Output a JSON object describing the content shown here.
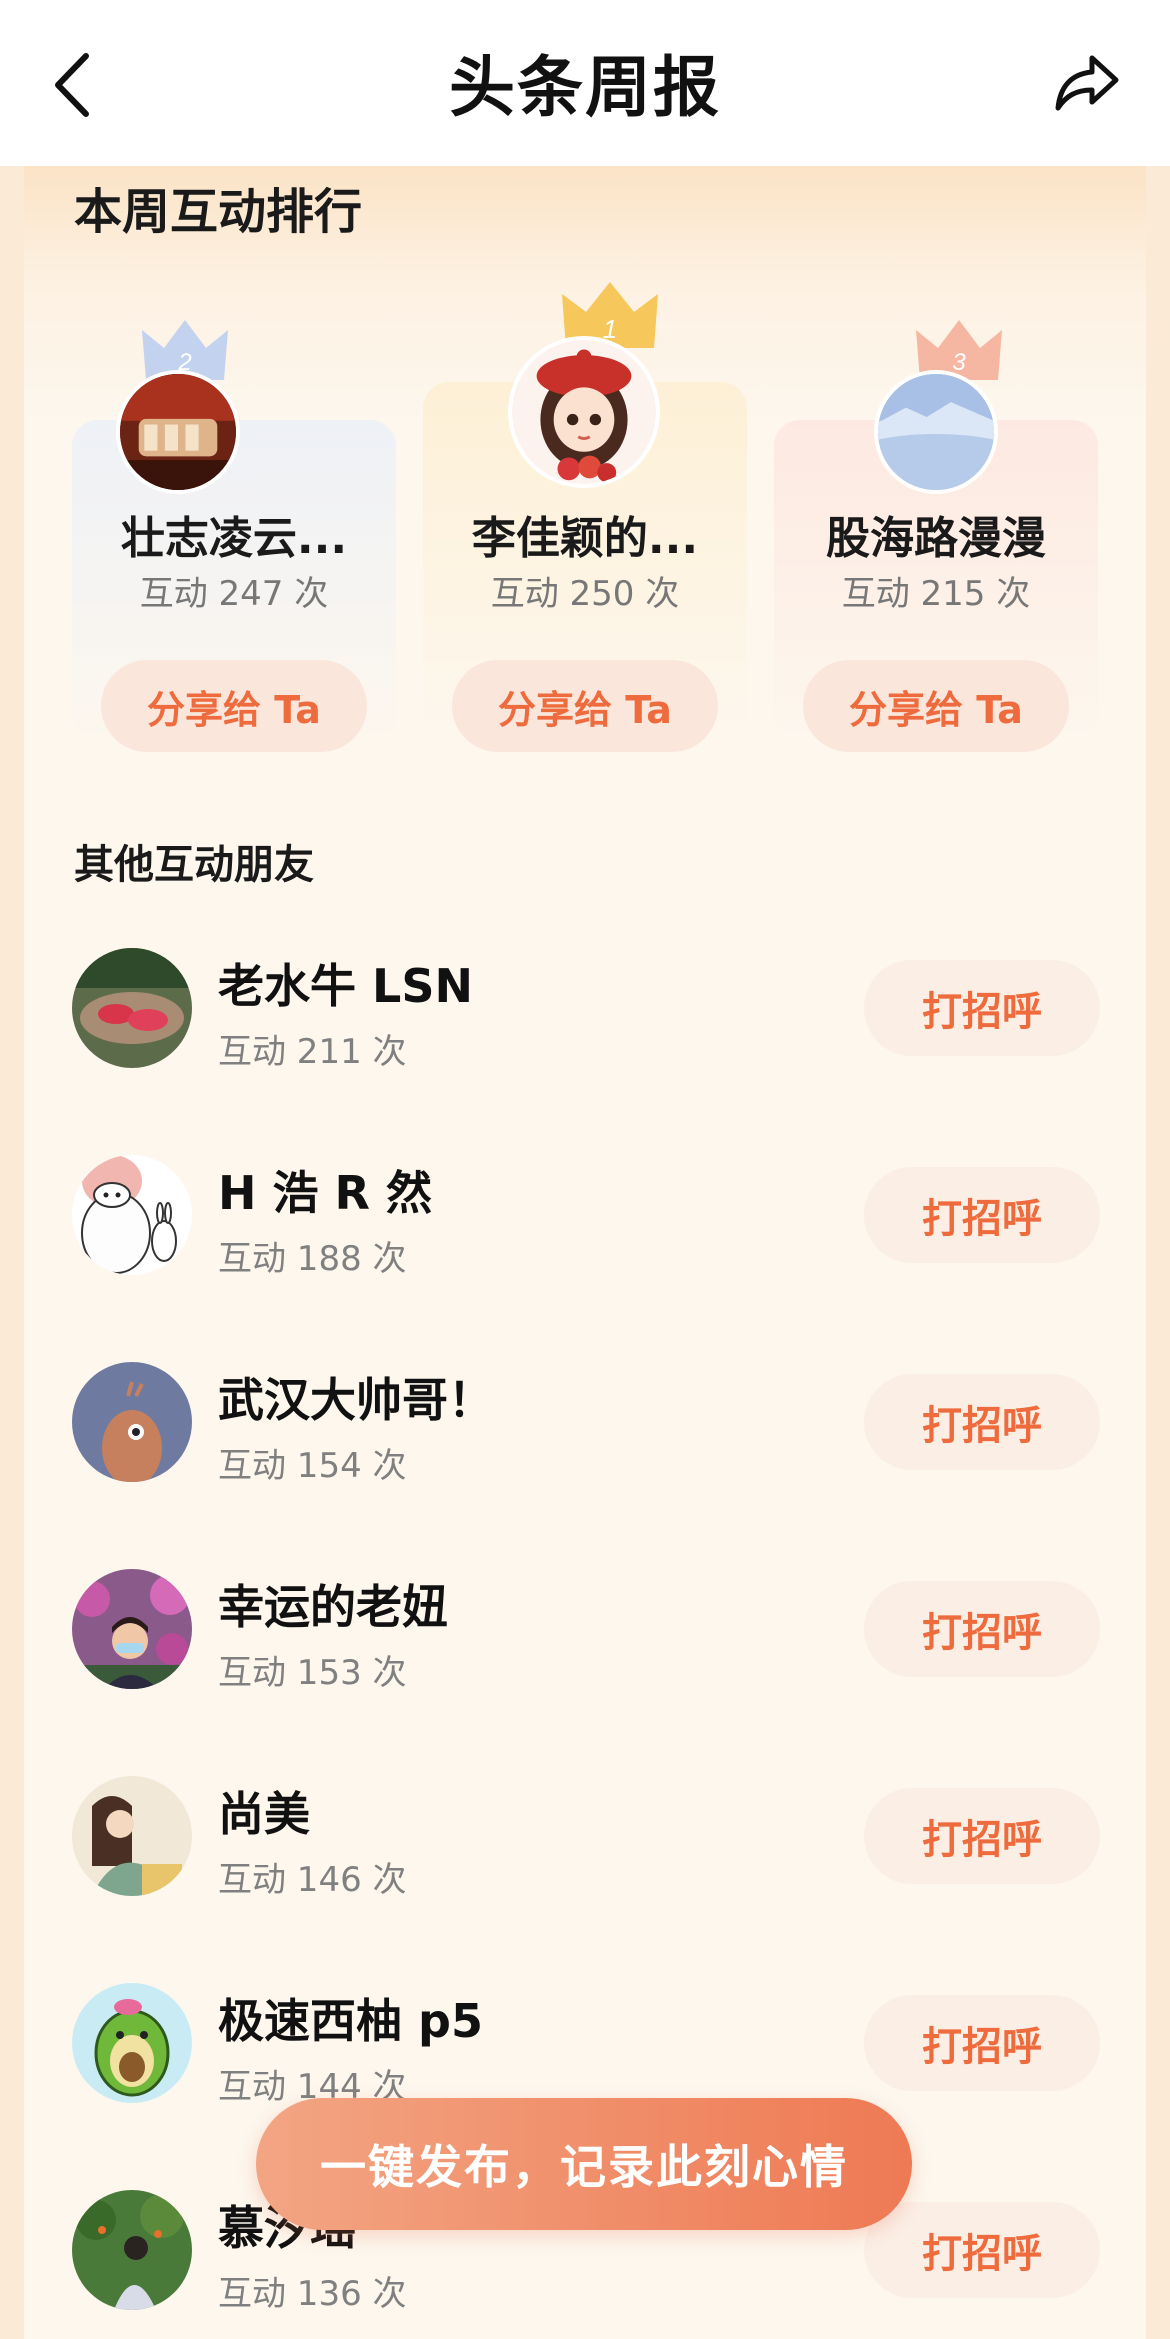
{
  "header": {
    "title": "头条周报",
    "back_icon": "chevron-left-icon",
    "share_icon": "share-arrow-icon"
  },
  "ranking": {
    "title": "本周互动排行",
    "podium": [
      {
        "rank": "2",
        "name": "壮志凌云...",
        "count": "互动 247 次",
        "button": "分享给 Ta",
        "crown_color": "#b8ccf0"
      },
      {
        "rank": "1",
        "name": "李佳颖的...",
        "count": "互动 250 次",
        "button": "分享给 Ta",
        "crown_color": "#f6c75a"
      },
      {
        "rank": "3",
        "name": "股海路漫漫",
        "count": "互动 215 次",
        "button": "分享给 Ta",
        "crown_color": "#f5b09a"
      }
    ]
  },
  "others": {
    "title": "其他互动朋友",
    "button_label": "打招呼",
    "items": [
      {
        "name": "老水牛 LSN",
        "count": "互动 211 次"
      },
      {
        "name": "H 浩 R 然",
        "count": "互动 188 次"
      },
      {
        "name": "武汉大帅哥！",
        "count": "互动 154 次"
      },
      {
        "name": "幸运的老妞",
        "count": "互动 153 次"
      },
      {
        "name": "尚美",
        "count": "互动 146 次"
      },
      {
        "name": "极速西柚 p5",
        "count": "互动 144 次"
      },
      {
        "name": "慕汐瑶",
        "count": "互动 136 次"
      }
    ]
  },
  "publish": {
    "label": "一键发布，记录此刻心情"
  },
  "colors": {
    "accent": "#ee6b3d",
    "background": "#fdf7ee"
  }
}
